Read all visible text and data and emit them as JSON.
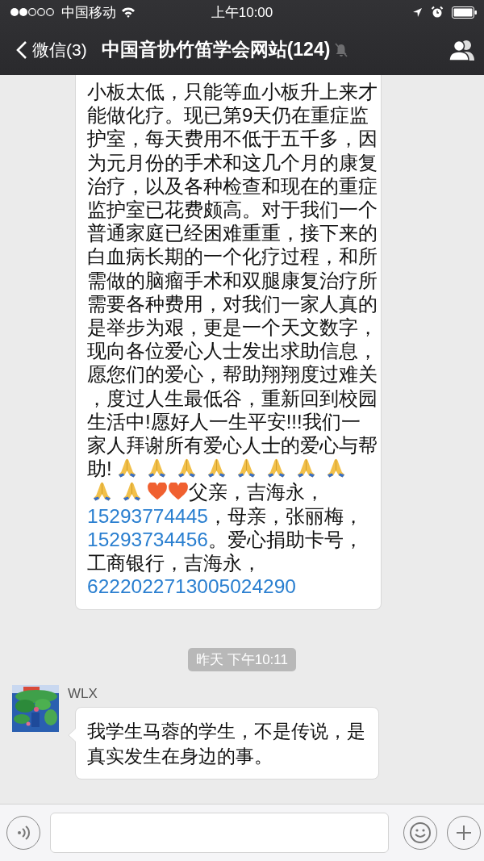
{
  "status_bar": {
    "carrier": "中国移动",
    "time": "上午10:00"
  },
  "nav": {
    "back_label": "微信(3)",
    "title": "中国音协竹笛学会网站(124)",
    "muted": true
  },
  "messages": [
    {
      "kind": "bubble",
      "segments": [
        {
          "kind": "text",
          "text": "小板太低，只能等血小板升上来才能做化疗。现已第9天仍在重症监护室，每天费用不低于五千多，因为元月份的手术和这几个月的康复治疗，以及各种检查和现在的重症监护室已花费颇高。对于我们一个普通家庭已经困难重重，接下来的白血病长期的一个化疗过程，和所需做的脑瘤手术和双腿康复治疗所需要各种费用，对我们一家人真的是举步为艰，更是一个天文数字，现向各位爱心人士发出求助信息，愿您们的爱心，帮助翔翔度过难关，度过人生最低谷，重新回到校园生活中!愿好人一生平安!!!我们一家人拜谢所有爱心人士的爱心与帮助!"
        },
        {
          "kind": "pray"
        },
        {
          "kind": "pray"
        },
        {
          "kind": "pray"
        },
        {
          "kind": "pray"
        },
        {
          "kind": "pray"
        },
        {
          "kind": "pray"
        },
        {
          "kind": "pray"
        },
        {
          "kind": "pray"
        },
        {
          "kind": "pray"
        },
        {
          "kind": "pray"
        },
        {
          "kind": "heart"
        },
        {
          "kind": "heart"
        },
        {
          "kind": "text",
          "text": "父亲，吉海永，"
        },
        {
          "kind": "link",
          "text": "15293774445"
        },
        {
          "kind": "text",
          "text": "，母亲，张丽梅，"
        },
        {
          "kind": "link",
          "text": "15293734456"
        },
        {
          "kind": "text",
          "text": "。爱心捐助卡号，工商银行，吉海永，"
        },
        {
          "kind": "link",
          "text": "6222022713005024290"
        }
      ]
    },
    {
      "kind": "timestamp",
      "text": "昨天 下午10:11"
    },
    {
      "kind": "bubble",
      "sender": "WLX",
      "segments": [
        {
          "kind": "text",
          "text": "我学生马蓉的学生，不是传说，是真实发生在身边的事。"
        }
      ]
    }
  ],
  "composer": {
    "kind": "text-input"
  }
}
